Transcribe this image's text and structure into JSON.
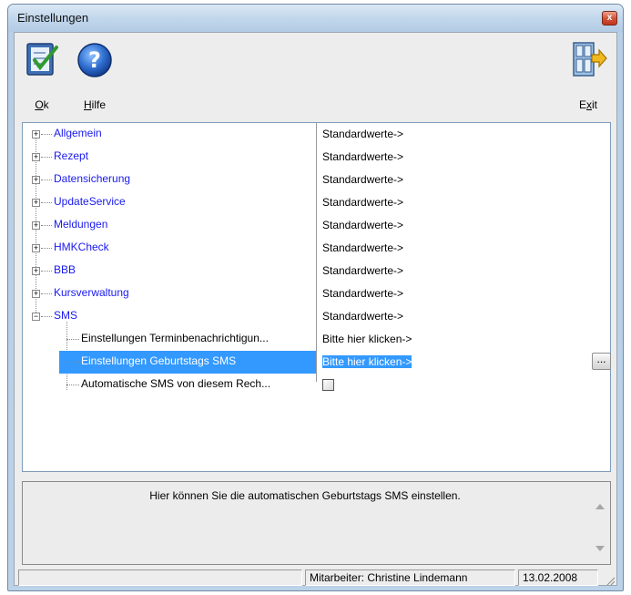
{
  "window": {
    "title": "Einstellungen",
    "close_label": "x"
  },
  "toolbar": {
    "ok": {
      "label_underlined": "O",
      "label_rest": "k",
      "icon": "ok-checklist-icon"
    },
    "help": {
      "label_underlined": "H",
      "label_rest": "ilfe",
      "icon": "help-question-icon"
    },
    "exit": {
      "label_pre": "E",
      "label_underlined": "x",
      "label_rest": "it",
      "icon": "exit-door-icon"
    }
  },
  "tree": {
    "categories": [
      {
        "label": "Allgemein",
        "value": "Standardwerte->",
        "expander": "+"
      },
      {
        "label": "Rezept",
        "value": "Standardwerte->",
        "expander": "+"
      },
      {
        "label": "Datensicherung",
        "value": "Standardwerte->",
        "expander": "+"
      },
      {
        "label": "UpdateService",
        "value": "Standardwerte->",
        "expander": "+"
      },
      {
        "label": "Meldungen",
        "value": "Standardwerte->",
        "expander": "+"
      },
      {
        "label": "HMKCheck",
        "value": "Standardwerte->",
        "expander": "+"
      },
      {
        "label": "BBB",
        "value": "Standardwerte->",
        "expander": "+"
      },
      {
        "label": "Kursverwaltung",
        "value": "Standardwerte->",
        "expander": "+"
      },
      {
        "label": "SMS",
        "value": "Standardwerte->",
        "expander": "−"
      }
    ],
    "sms_children": [
      {
        "label": "Einstellungen Terminbenachrichtigun...",
        "value": "Bitte hier klicken->"
      },
      {
        "label": "Einstellungen Geburtstags SMS",
        "value": "Bitte hier klicken->",
        "selected": true,
        "button_label": "..."
      },
      {
        "label": "Automatische SMS von diesem Rech...",
        "checkbox": true,
        "checked": false
      }
    ]
  },
  "description": {
    "text": "Hier können Sie die automatischen Geburtstags SMS einstellen."
  },
  "status": {
    "pane_left": "",
    "employee": "Mitarbeiter:  Christine Lindemann",
    "date": "13.02.2008"
  },
  "colors": {
    "link": "#1a1aee",
    "selection": "#3399ff"
  }
}
